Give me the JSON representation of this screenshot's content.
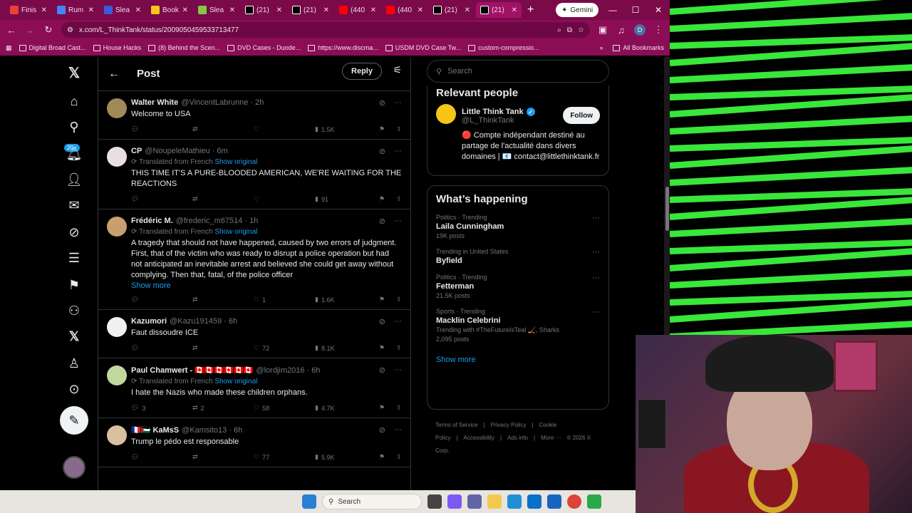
{
  "browser": {
    "tabs": [
      {
        "label": "Finis",
        "color": "#ea4335"
      },
      {
        "label": "Rum",
        "color": "#4285f4"
      },
      {
        "label": "Slea",
        "color": "#3b5bdb"
      },
      {
        "label": "Book",
        "color": "#f5c518"
      },
      {
        "label": "Slea",
        "color": "#85c742"
      },
      {
        "label": "(21)",
        "color": "#000000"
      },
      {
        "label": "(21)",
        "color": "#000000"
      },
      {
        "label": "(440",
        "color": "#ff0000"
      },
      {
        "label": "(440",
        "color": "#ff0000"
      },
      {
        "label": "(21)",
        "color": "#000000"
      },
      {
        "label": "(21)",
        "color": "#000000"
      }
    ],
    "gemini_label": "Gemini",
    "url": "x.com/L_ThinkTank/status/2009050459533713477",
    "profile_initial": "D",
    "bookmarks": [
      "Digital Broad Cast...",
      "House Hacks",
      "(8) Behind the Scen...",
      "DVD Cases - Duode...",
      "https://www.discma...",
      "USDM DVD Case Tw...",
      "custom-compressio..."
    ],
    "all_bookmarks": "All Bookmarks"
  },
  "nav": {
    "badge": "20+"
  },
  "main": {
    "title": "Post",
    "reply_label": "Reply",
    "tweets": [
      {
        "name": "Walter White",
        "handle": "@VincentLabrunne · 2h",
        "translated": false,
        "text": "Welcome to USA",
        "show_more": "",
        "replies": "",
        "reposts": "",
        "likes": "",
        "views": "1.5K",
        "avatar_color": "#a08a5a"
      },
      {
        "name": "CP",
        "handle": "@NoupeleMathieu · 6m",
        "translated": true,
        "text": "THIS TIME IT'S A PURE-BLOODED AMERICAN, WE'RE WAITING FOR THE REACTIONS",
        "show_more": "",
        "replies": "",
        "reposts": "",
        "likes": "",
        "views": "91",
        "avatar_color": "#e8e0e0"
      },
      {
        "name": "Frédéric M.",
        "handle": "@frederic_m67514 · 1h",
        "translated": true,
        "text": "A tragedy that should not have happened, caused by two errors of judgment. First, that of the victim who was ready to disrupt a police operation but had not anticipated an inevitable arrest and believed she could get away without complying. Then that, fatal, of the police officer",
        "show_more": "Show more",
        "replies": "",
        "reposts": "",
        "likes": "1",
        "views": "1.6K",
        "avatar_color": "#c8a070"
      },
      {
        "name": "Kazumori",
        "handle": "@Kazu191459 · 6h",
        "translated": false,
        "text": "Faut dissoudre ICE",
        "show_more": "",
        "replies": "",
        "reposts": "",
        "likes": "72",
        "views": "8.1K",
        "avatar_color": "#f0f0f0"
      },
      {
        "name": "Paul Chamwert - 🇨🇦🇨🇦🇨🇦🇨🇦🇨🇦🇨🇦",
        "handle": "@lordjim2016 · 6h",
        "translated": true,
        "text": "I hate the Nazis who made these children orphans.",
        "show_more": "",
        "replies": "3",
        "reposts": "2",
        "likes": "58",
        "views": "4.7K",
        "avatar_color": "#c0d8a0"
      },
      {
        "name": "🇫🇷🇵🇸 KaMsS",
        "handle": "@Kamsito13 · 6h",
        "translated": false,
        "text": "Trump le pédo est responsable",
        "show_more": "",
        "replies": "",
        "reposts": "",
        "likes": "77",
        "views": "5.9K",
        "avatar_color": "#d8c0a0"
      }
    ],
    "translated_label": "Translated from French",
    "show_original": "Show original"
  },
  "right": {
    "search_placeholder": "Search",
    "relevant_title": "Relevant people",
    "relevant": {
      "name": "Little Think Tank",
      "handle": "@L_ThinkTank",
      "follow": "Follow",
      "bio": "🔴 Compte indépendant destiné au partage de l'actualité dans divers domaines | 📧 contact@littlethinktank.fr"
    },
    "happening_title": "What’s happening",
    "trends": [
      {
        "meta": "Politics · Trending",
        "name": "Laila Cunningham",
        "count": "19K posts",
        "with": ""
      },
      {
        "meta": "Trending in United States",
        "name": "Byfield",
        "count": "",
        "with": ""
      },
      {
        "meta": "Politics · Trending",
        "name": "Fetterman",
        "count": "21.5K posts",
        "with": ""
      },
      {
        "meta": "Sports · Trending",
        "name": "Macklin Celebrini",
        "count": "2,095 posts",
        "with": "Trending with #TheFutureIsTeal 🏒, Sharks"
      }
    ],
    "show_more": "Show more",
    "footer": [
      "Terms of Service",
      "|",
      "Privacy Policy",
      "|",
      "Cookie Policy",
      "|",
      "Accessibility",
      "|",
      "Ads info",
      "|",
      "More ···",
      "© 2026 X Corp."
    ]
  },
  "taskbar": {
    "search_label": "Search"
  },
  "colors": {
    "chrome_accent": "#8a0d55",
    "x_link": "#1d9bf0",
    "stripe_green": "#39e63a"
  }
}
